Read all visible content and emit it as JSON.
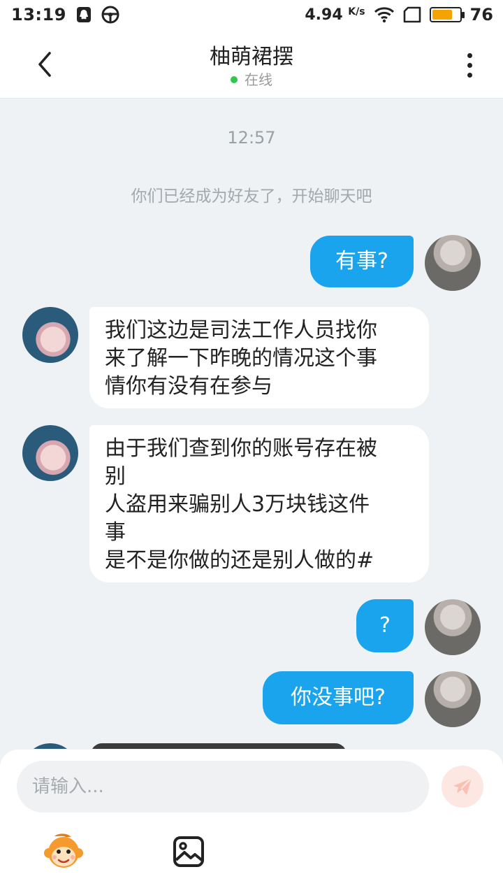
{
  "status_bar": {
    "time": "13:19",
    "speed": "4.94",
    "speed_unit": "K/s",
    "battery": "76",
    "battery_level": 0.76,
    "icons": [
      "qq-icon",
      "steering-wheel-icon",
      "wifi-icon",
      "screen-icon",
      "battery-icon"
    ]
  },
  "header": {
    "title": "柚萌裙摆",
    "status": "在线",
    "status_color": "#2ec84a"
  },
  "chat": {
    "timestamp": "12:57",
    "system_message": "你们已经成为好友了，开始聊天吧",
    "messages": [
      {
        "side": "out",
        "lines": [
          "有事?"
        ]
      },
      {
        "side": "in",
        "lines": [
          "我们这边是司法工作人员找你",
          "来了解一下昨晚的情况这个事",
          "情你有没有在参与"
        ]
      },
      {
        "side": "in",
        "lines": [
          "由于我们查到你的账号存在被",
          "别",
          "人盗用来骗别人3万块钱这件",
          "事",
          "是不是你做的还是别人做的#"
        ]
      },
      {
        "side": "out",
        "lines": [
          "?"
        ]
      },
      {
        "side": "out",
        "lines": [
          "你没事吧?"
        ]
      }
    ]
  },
  "input": {
    "placeholder": "请输入..."
  },
  "colors": {
    "accent": "#1aa4ee",
    "background": "#eef2f4"
  }
}
